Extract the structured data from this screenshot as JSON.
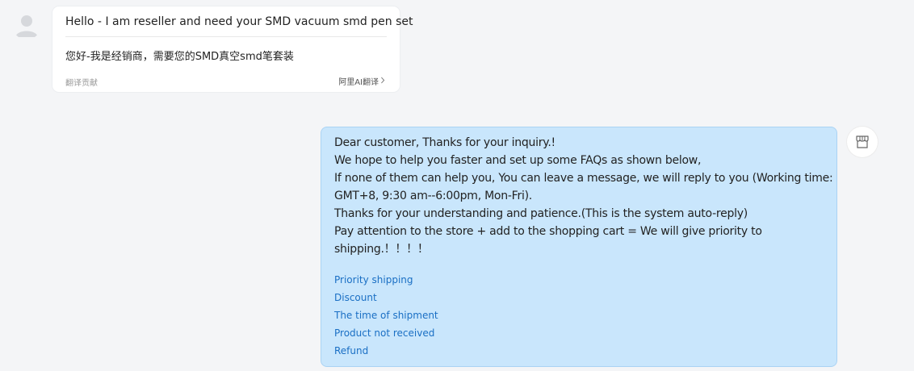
{
  "incoming_message": {
    "original_text": "Hello - I am reseller and need your SMD vacuum smd pen set",
    "translated_text": "您好-我是经销商，需要您的SMD真空smd笔套装",
    "contribute_label": "翻译贡献",
    "ai_translate_label": "阿里AI翻译",
    "chevron_icon": "chevron-right-icon"
  },
  "reply_message": {
    "lines": [
      "Dear customer, Thanks for your inquiry.!",
      "We hope to help you faster and set up some FAQs as shown below,",
      "If none of them can help you, You can leave a message, we will reply to you (Working time:",
      "GMT+8, 9:30 am--6:00pm, Mon-Fri).",
      "Thanks for your understanding and patience.(This is the system auto-reply)",
      "Pay attention to the store + add to the shopping cart = We will give priority to",
      "shipping.！！！！"
    ],
    "faq_links": [
      "Priority shipping",
      "Discount",
      "The time of shipment",
      "Product not received",
      "Refund"
    ]
  },
  "icons": {
    "user_avatar": "user-avatar-icon",
    "store_avatar": "store-icon"
  },
  "colors": {
    "background": "#f4f5f7",
    "reply_bubble": "#c9e6fc",
    "link": "#1a6fc4"
  }
}
